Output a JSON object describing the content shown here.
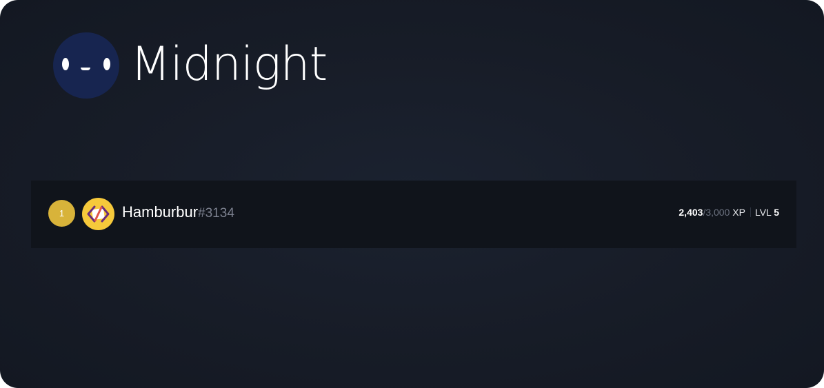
{
  "server": {
    "name": "Midnight",
    "avatar_icon": "smiley-face-icon",
    "avatar_color": "#172550"
  },
  "leaderboard": [
    {
      "rank": "1",
      "rank_color": "#d8b33a",
      "username": "Hamburbur",
      "discriminator": "#3134",
      "avatar_icon": "code-brackets-icon",
      "avatar_color": "#f6c93b",
      "xp_current": "2,403",
      "xp_separator": "/",
      "xp_required": "3,000",
      "xp_label": "XP",
      "level_label": "LVL",
      "level": "5"
    }
  ]
}
